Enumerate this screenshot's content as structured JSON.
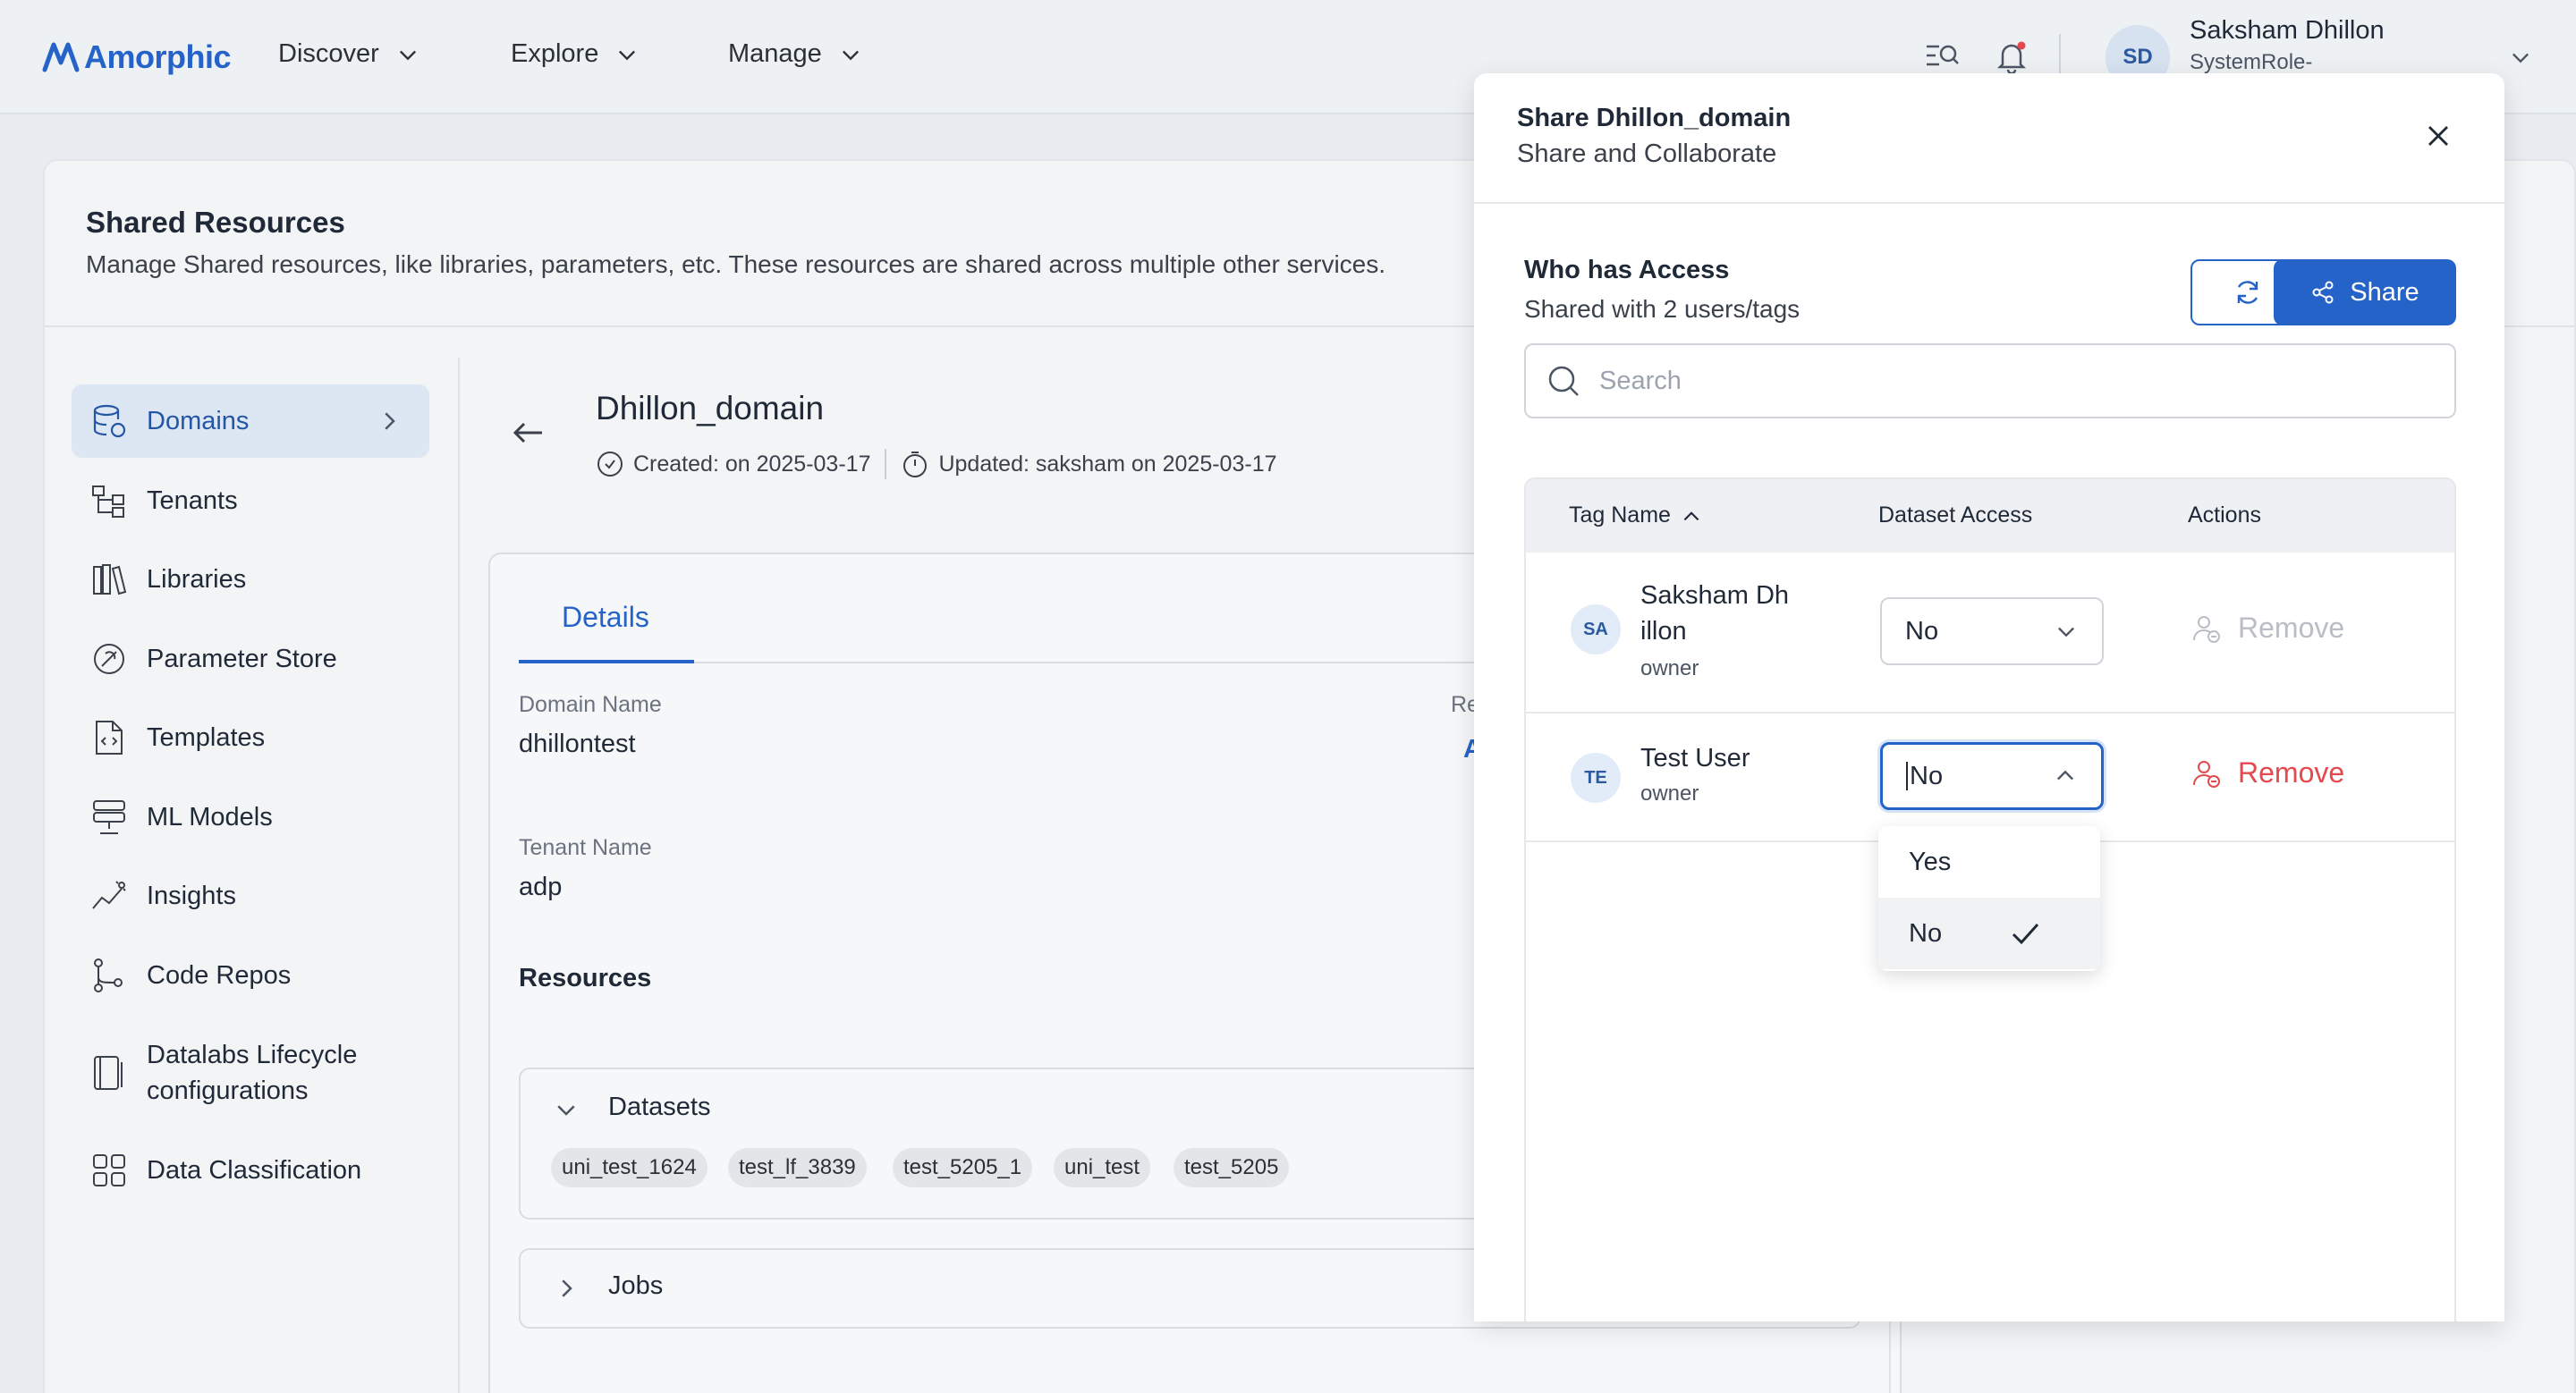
{
  "app": {
    "logo_text": "Amorphic",
    "brand_color": "#2563c9"
  },
  "nav": {
    "items": [
      "Discover",
      "Explore",
      "Manage"
    ]
  },
  "user": {
    "initials": "SD",
    "name": "Saksham Dhillon",
    "role": "SystemRole-"
  },
  "page": {
    "title": "Shared Resources",
    "subtitle": "Manage Shared resources, like libraries, parameters, etc. These resources are shared across multiple other services."
  },
  "sidebar": {
    "items": [
      {
        "label": "Domains",
        "icon": "database-icon",
        "active": true
      },
      {
        "label": "Tenants",
        "icon": "hierarchy-icon"
      },
      {
        "label": "Libraries",
        "icon": "library-icon"
      },
      {
        "label": "Parameter Store",
        "icon": "parameter-icon"
      },
      {
        "label": "Templates",
        "icon": "template-file-icon"
      },
      {
        "label": "ML Models",
        "icon": "server-stack-icon"
      },
      {
        "label": "Insights",
        "icon": "insights-chart-icon"
      },
      {
        "label": "Code Repos",
        "icon": "git-branch-icon"
      },
      {
        "label": "Datalabs Lifecycle",
        "label2": "configurations",
        "icon": "lifecycle-icon"
      },
      {
        "label": "Data Classification",
        "icon": "grid-icon"
      }
    ]
  },
  "domain": {
    "title": "Dhillon_domain",
    "created": "Created: on 2025-03-17",
    "updated": "Updated: saksham on 2025-03-17",
    "tab": "Details",
    "fields": {
      "domain_name_label": "Domain Name",
      "domain_name_value": "dhillontest",
      "tenant_name_label": "Tenant Name",
      "tenant_name_value": "adp",
      "partial_label": "Re",
      "partial_value": "A"
    },
    "resources_title": "Resources",
    "datasets_title": "Datasets",
    "datasets": [
      "uni_test_1624",
      "test_lf_3839",
      "test_5205_1",
      "uni_test",
      "test_5205"
    ],
    "jobs_title": "Jobs"
  },
  "modal": {
    "title": "Share Dhillon_domain",
    "subtitle": "Share and Collaborate",
    "access_title": "Who has Access",
    "access_sub": "Shared with 2 users/tags",
    "share_label": "Share",
    "search_placeholder": "Search",
    "columns": [
      "Tag Name",
      "Dataset Access",
      "Actions"
    ],
    "rows": [
      {
        "initials": "SA",
        "name": "Saksham Dh illon",
        "name_line1": "Saksham Dh",
        "name_line2": "illon",
        "role": "owner",
        "access": "No",
        "action": "Remove",
        "action_enabled": false
      },
      {
        "initials": "TE",
        "name": "Test User",
        "role": "owner",
        "access": "No",
        "action": "Remove",
        "action_enabled": true
      }
    ],
    "dropdown_options": [
      "Yes",
      "No"
    ],
    "dropdown_selected": "No"
  }
}
